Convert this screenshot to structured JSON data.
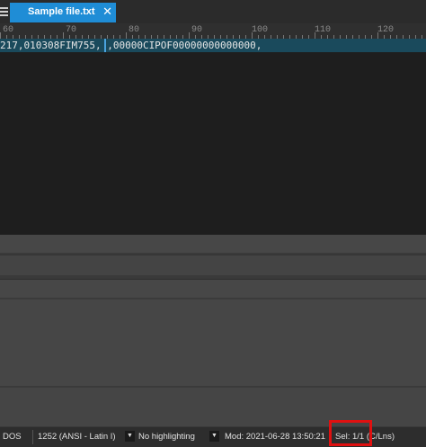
{
  "tab": {
    "title": "Sample file.txt",
    "close_glyph": "✕"
  },
  "ruler": {
    "labels": [
      "60",
      "70",
      "80",
      "90",
      "100",
      "110",
      "120"
    ]
  },
  "editor": {
    "line_text": "217,010308FIM755, ,00000CIPOF00000000000000,"
  },
  "statusbar": {
    "line_ending": "DOS",
    "encoding": "1252  (ANSI - Latin I)",
    "highlighting": "No highlighting",
    "modified": "Mod: 2021-06-28 13:50:21",
    "selection": "Sel: 1/1 (C/Lns)"
  },
  "colors": {
    "tab_active": "#1f8dd6",
    "current_line": "#1a4a5c",
    "highlight_box": "#e01010"
  },
  "icons": {
    "tab_menu": "hamburger-icon",
    "dropdown": "chevron-down-icon",
    "close": "close-icon"
  }
}
